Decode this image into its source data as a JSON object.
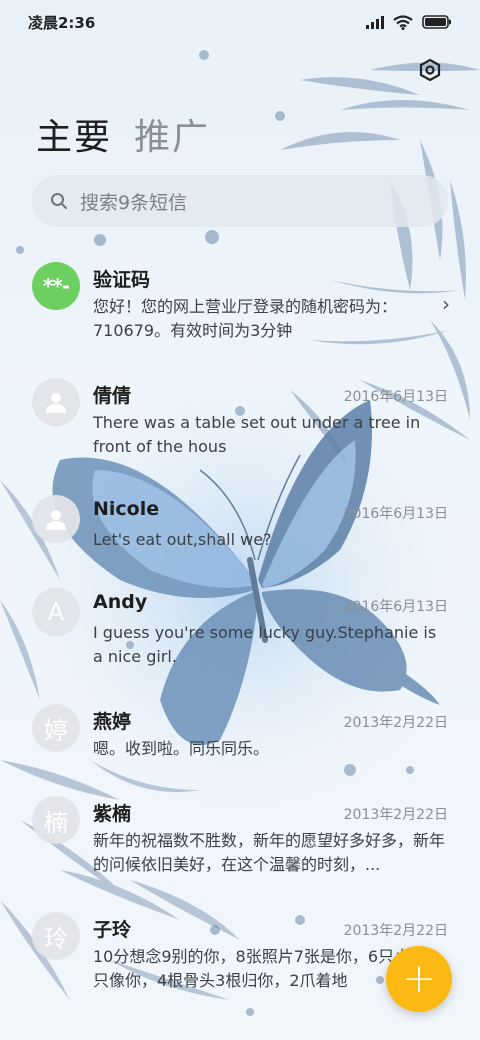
{
  "status_bar": {
    "time": "凌晨2:36"
  },
  "tabs": [
    {
      "label": "主要"
    },
    {
      "label": "推广"
    }
  ],
  "search": {
    "placeholder": "搜索9条短信"
  },
  "conversations": [
    {
      "name": "验证码",
      "date": "",
      "avatar_text": "**-",
      "avatar_color": "#6ccf60",
      "preview": "您好！您的网上营业厅登录的随机密码为：710679。有效时间为3分钟"
    },
    {
      "name": "倩倩",
      "date": "2016年6月13日",
      "avatar_text": "",
      "avatar_color": "#e1e4e8",
      "preview": "There was a table set out under a tree in front of the hous"
    },
    {
      "name": "Nicole",
      "date": "2016年6月13日",
      "avatar_text": "",
      "avatar_color": "#e1e4e8",
      "preview": "Let's eat out,shall we?"
    },
    {
      "name": "Andy",
      "date": "2016年6月13日",
      "avatar_text": "A",
      "avatar_color": "#e1e4e8",
      "preview": "I guess you're some lucky guy.Stephanie is a nice girl."
    },
    {
      "name": "燕婷",
      "date": "2013年2月22日",
      "avatar_text": "婷",
      "avatar_color": "#e1e4e8",
      "preview": "嗯。收到啦。同乐同乐。"
    },
    {
      "name": "紫楠",
      "date": "2013年2月22日",
      "avatar_text": "楠",
      "avatar_color": "#e1e4e8",
      "preview": "新年的祝福数不胜数，新年的愿望好多好多，新年的问候依旧美好，在这个温馨的时刻，..."
    },
    {
      "name": "子玲",
      "date": "2013年2月22日",
      "avatar_text": "玲",
      "avatar_color": "#e1e4e8",
      "preview": "10分想念9别的你，8张照片7张是你，6只小狗5只像你，4根骨头3根归你，2爪着地"
    }
  ],
  "fab": {
    "label": "+",
    "color": "#fdb913"
  }
}
